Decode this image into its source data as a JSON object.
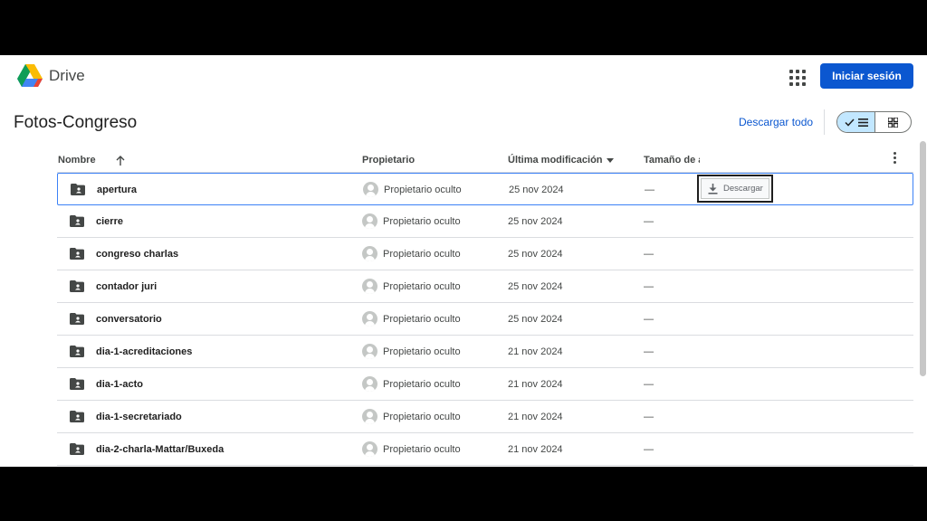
{
  "header": {
    "brand": "Drive",
    "signin_label": "Iniciar sesión"
  },
  "folder": {
    "title": "Fotos-Congreso",
    "download_all_label": "Descargar todo"
  },
  "columns": {
    "name": "Nombre",
    "owner": "Propietario",
    "modified": "Última modificación",
    "size": "Tamaño de a"
  },
  "rows": [
    {
      "name": "apertura",
      "owner": "Propietario oculto",
      "date": "25 nov 2024",
      "size": "—"
    },
    {
      "name": "cierre",
      "owner": "Propietario oculto",
      "date": "25 nov 2024",
      "size": "—"
    },
    {
      "name": "congreso charlas",
      "owner": "Propietario oculto",
      "date": "25 nov 2024",
      "size": "—"
    },
    {
      "name": "contador juri",
      "owner": "Propietario oculto",
      "date": "25 nov 2024",
      "size": "—"
    },
    {
      "name": "conversatorio",
      "owner": "Propietario oculto",
      "date": "25 nov 2024",
      "size": "—"
    },
    {
      "name": "dia-1-acreditaciones",
      "owner": "Propietario oculto",
      "date": "21 nov 2024",
      "size": "—"
    },
    {
      "name": "dia-1-acto",
      "owner": "Propietario oculto",
      "date": "21 nov 2024",
      "size": "—"
    },
    {
      "name": "dia-1-secretariado",
      "owner": "Propietario oculto",
      "date": "21 nov 2024",
      "size": "—"
    },
    {
      "name": "dia-2-charla-Mattar/Buxeda",
      "owner": "Propietario oculto",
      "date": "21 nov 2024",
      "size": "—"
    }
  ],
  "row_action": {
    "download_label": "Descargar"
  },
  "colors": {
    "accent": "#0b57d0",
    "selected_border": "#3c82f6",
    "toggle_active": "#c2e7ff"
  },
  "icons": {
    "row": "shared-folder-icon",
    "sort": "arrow-up-icon",
    "menu": "more-vert-icon"
  }
}
